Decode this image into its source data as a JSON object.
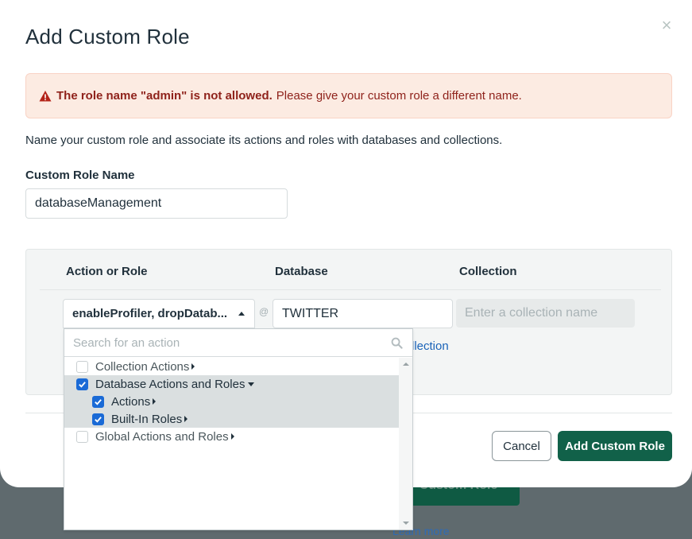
{
  "background": {
    "button_label": "Custom Role",
    "link_label": "Learn more"
  },
  "modal": {
    "title": "Add Custom Role",
    "close_icon": "×"
  },
  "alert": {
    "icon": "warning-icon",
    "bold_text": "The role name \"admin\" is not allowed.",
    "text": "Please give your custom role a different name."
  },
  "description": "Name your custom role and associate its actions and roles with databases and collections.",
  "role_name": {
    "label": "Custom Role Name",
    "value": "databaseManagement"
  },
  "table": {
    "headers": {
      "action": "Action or Role",
      "database": "Database",
      "collection": "Collection"
    },
    "row": {
      "action_value": "enableProfiler, dropDatab...",
      "at_sign": "@",
      "database_value": "TWITTER",
      "collection_placeholder": "Enter a collection name"
    },
    "add_collection_link": "llection"
  },
  "dropdown": {
    "search_placeholder": "Search for an action",
    "items": [
      {
        "label": "Collection Actions",
        "checked": false,
        "expanded": false,
        "indent": 0
      },
      {
        "label": "Database Actions and Roles",
        "checked": true,
        "expanded": true,
        "indent": 0
      },
      {
        "label": "Actions",
        "checked": true,
        "expanded": false,
        "indent": 1
      },
      {
        "label": "Built-In Roles",
        "checked": true,
        "expanded": false,
        "indent": 1
      },
      {
        "label": "Global Actions and Roles",
        "checked": false,
        "expanded": false,
        "indent": 0
      }
    ]
  },
  "footer": {
    "cancel_label": "Cancel",
    "submit_label": "Add Custom Role"
  },
  "colors": {
    "primary_green": "#116149",
    "alert_bg": "#fcebe2",
    "alert_text": "#8f221b",
    "checkbox_blue": "#1a6ad6",
    "link_blue": "#1a63b8"
  }
}
